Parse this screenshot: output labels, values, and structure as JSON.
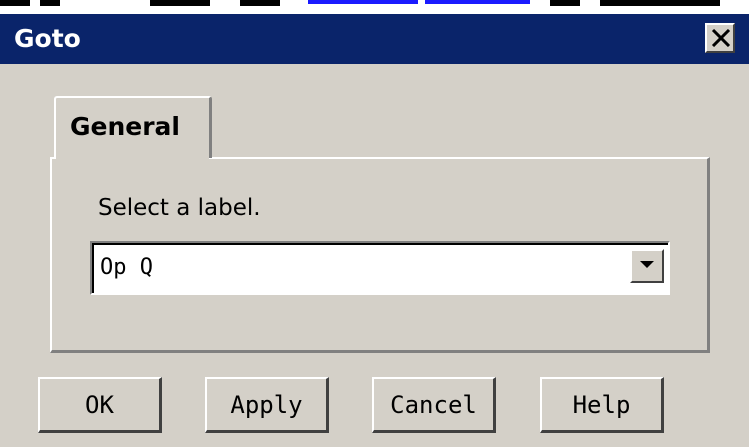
{
  "dialog": {
    "title": "Goto",
    "tab_label": "General",
    "prompt": "Select a label.",
    "combo_value": "Op Q",
    "buttons": {
      "ok": "OK",
      "apply": "Apply",
      "cancel": "Cancel",
      "help": "Help"
    }
  },
  "icons": {
    "close": "close-icon",
    "dropdown": "chevron-down-icon"
  },
  "colors": {
    "titlebar": "#0a246a",
    "face": "#d4d0c8",
    "link": "#1a1aff"
  }
}
